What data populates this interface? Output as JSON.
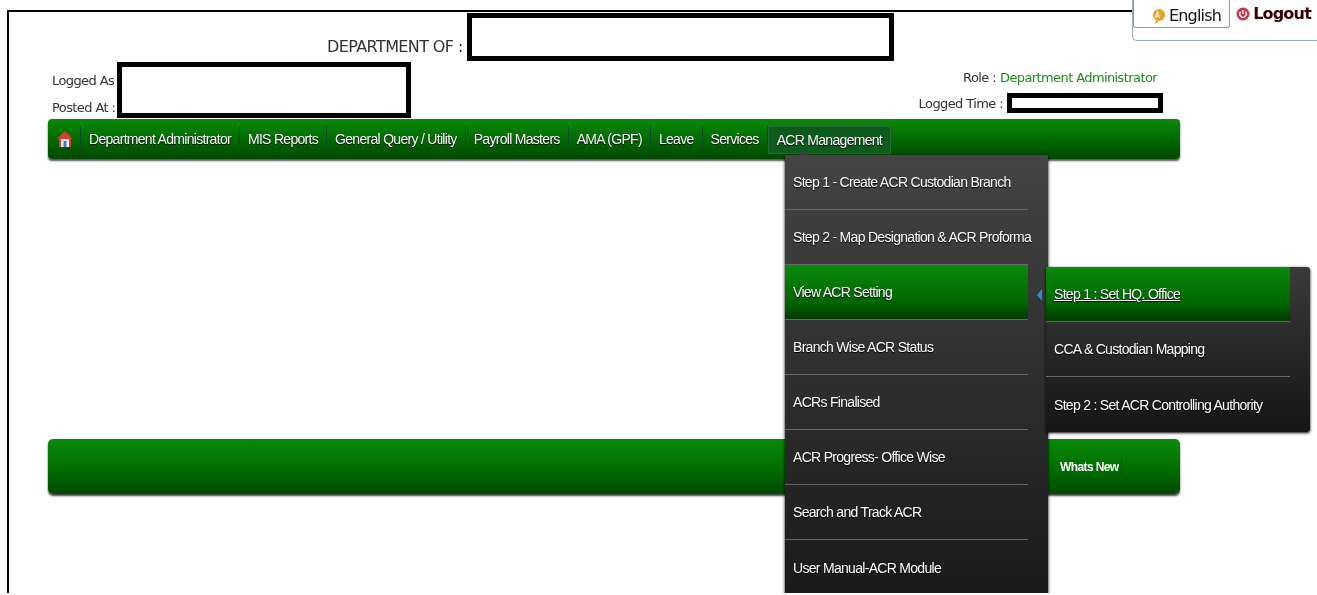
{
  "header": {
    "department_label": "DEPARTMENT OF :",
    "logged_as_label": "Logged As",
    "posted_at_label": "Posted At :",
    "role_label": "Role :",
    "role_value": "Department Administrator",
    "logged_time_label": "Logged Time :"
  },
  "top_links": [
    {
      "kind": "language",
      "label": "English"
    },
    {
      "kind": "logout",
      "label": "Logout"
    }
  ],
  "nav": {
    "items": [
      {
        "kind": "home",
        "selected": false
      },
      {
        "kind": "text",
        "label": "Department Administrator",
        "selected": false
      },
      {
        "kind": "text",
        "label": "MIS Reports",
        "selected": false
      },
      {
        "kind": "text",
        "label": "General Query / Utility",
        "selected": false
      },
      {
        "kind": "text",
        "label": "Payroll Masters",
        "selected": false
      },
      {
        "kind": "text",
        "label": "AMA (GPF)",
        "selected": false
      },
      {
        "kind": "text",
        "label": "Leave",
        "selected": false
      },
      {
        "kind": "text",
        "label": "Services",
        "selected": false
      },
      {
        "kind": "text",
        "label": "ACR Management",
        "selected": true
      }
    ]
  },
  "dropdown": {
    "items": [
      {
        "label": "Step 1 - Create ACR Custodian Branch",
        "selected": false
      },
      {
        "label": "Step 2 - Map Designation & ACR Proforma",
        "selected": false
      },
      {
        "label": "View ACR Setting",
        "selected": true
      },
      {
        "label": "Branch Wise ACR Status",
        "selected": false
      },
      {
        "label": "ACRs Finalised",
        "selected": false
      },
      {
        "label": "ACR Progress- Office Wise",
        "selected": false
      },
      {
        "label": "Search and Track ACR",
        "selected": false
      },
      {
        "label": "User Manual-ACR Module",
        "selected": false
      }
    ]
  },
  "submenu": {
    "items": [
      {
        "label": "Step 1 : Set HQ. Office",
        "selected": true
      },
      {
        "label": "CCA & Custodian Mapping",
        "selected": false
      },
      {
        "label": "Step 2 : Set ACR Controlling Authority",
        "selected": false
      }
    ]
  },
  "news_bar": {
    "label": "Whats New"
  }
}
